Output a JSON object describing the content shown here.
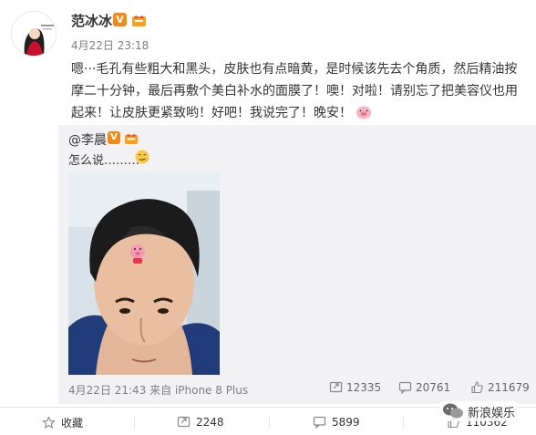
{
  "post": {
    "author": "范冰冰",
    "badge": "V",
    "time": "4月22日 23:18",
    "text": "嗯···毛孔有些粗大和黑头，皮肤也有点暗黄，是时候该先去个角质，然后精油按摩二十分钟，最后再敷个美白补水的面膜了！噢！对啦！请别忘了把美容仪也用起来！让皮肤更紧致哟！好吧！我说完了！晚安！",
    "emoji": "pig-face"
  },
  "repost": {
    "author": "@李晨",
    "badge": "V",
    "text": "怎么说………",
    "emoji": "smirk-face",
    "meta": "4月22日 21:43 来自 iPhone 8 Plus",
    "stats": {
      "reposts": "12335",
      "comments": "20761",
      "likes": "211679"
    }
  },
  "footer": {
    "favorite_label": "收藏",
    "reposts": "2248",
    "comments": "5899",
    "likes": "110362"
  },
  "watermark": {
    "text": "新浪娱乐"
  },
  "colors": {
    "accent": "#f08a1a",
    "gray_text": "#808080",
    "repost_bg": "#f2f2f5"
  }
}
